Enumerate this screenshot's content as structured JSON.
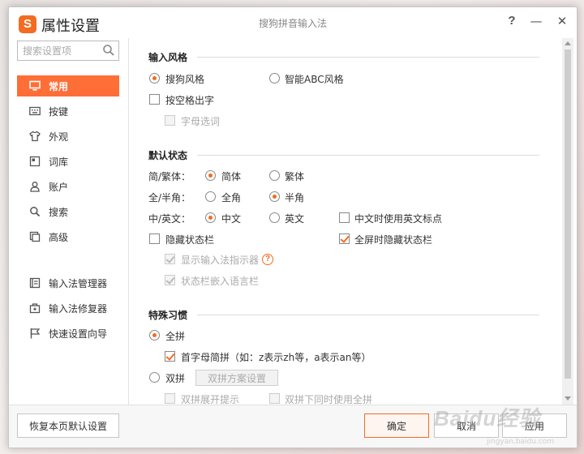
{
  "window": {
    "logo_letter": "S",
    "title": "属性设置",
    "subtitle": "搜狗拼音输入法",
    "help": "?",
    "minimize": "—",
    "close": "✕"
  },
  "sidebar": {
    "search_placeholder": "搜索设置项",
    "items": [
      {
        "label": "常用",
        "icon": "monitor-icon",
        "active": true
      },
      {
        "label": "按键",
        "icon": "keyboard-icon"
      },
      {
        "label": "外观",
        "icon": "shirt-icon"
      },
      {
        "label": "词库",
        "icon": "book-icon"
      },
      {
        "label": "账户",
        "icon": "user-icon"
      },
      {
        "label": "搜索",
        "icon": "search-icon"
      },
      {
        "label": "高级",
        "icon": "advanced-icon"
      }
    ],
    "tools": [
      {
        "label": "输入法管理器",
        "icon": "manager-icon"
      },
      {
        "label": "输入法修复器",
        "icon": "repair-icon"
      },
      {
        "label": "快速设置向导",
        "icon": "flag-icon"
      }
    ]
  },
  "input_style": {
    "title": "输入风格",
    "sogou_style": "搜狗风格",
    "abc_style": "智能ABC风格",
    "space_output": "按空格出字",
    "letter_select": "字母选词"
  },
  "default_state": {
    "title": "默认状态",
    "trad_simp_label": "简/繁体：",
    "simplified": "简体",
    "traditional": "繁体",
    "width_label": "全/半角：",
    "full_width": "全角",
    "half_width": "半角",
    "lang_label": "中/英文：",
    "chinese": "中文",
    "english": "英文",
    "chinese_en_punct": "中文时使用英文标点",
    "hide_statusbar": "隐藏状态栏",
    "fullscreen_hide_statusbar": "全屏时隐藏状态栏",
    "show_indicator": "显示输入法指示器",
    "help_mark": "?",
    "embed_langbar": "状态栏嵌入语言栏"
  },
  "special_habits": {
    "title": "特殊习惯",
    "quanpin": "全拼",
    "initial_abbrev": "首字母简拼（如：z表示zh等，a表示an等）",
    "shuangpin": "双拼",
    "shuangpin_scheme": "双拼方案设置",
    "shuangpin_expand": "双拼展开提示",
    "shuangpin_with_quanpin": "双拼下同时使用全拼"
  },
  "footer": {
    "restore": "恢复本页默认设置",
    "ok": "确定",
    "cancel": "取消",
    "apply": "应用"
  },
  "watermark": {
    "brand": "Baidu经验",
    "url": "jingyan.baidu.com"
  },
  "colors": {
    "accent": "#f26c21",
    "active_nav": "#ff6e37"
  }
}
